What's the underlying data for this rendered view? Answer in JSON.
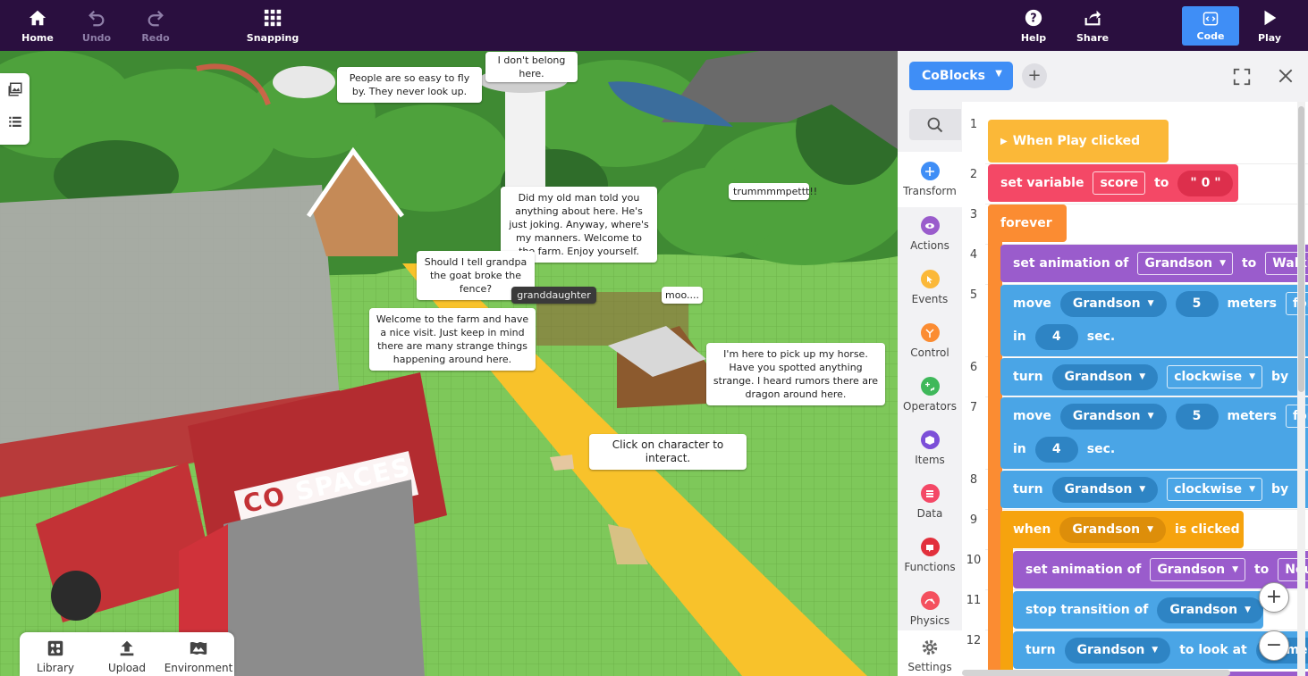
{
  "topbar": {
    "home": "Home",
    "undo": "Undo",
    "redo": "Redo",
    "snapping": "Snapping",
    "help": "Help",
    "share": "Share",
    "code": "Code",
    "play": "Play"
  },
  "scene": {
    "bubbles": {
      "fly": "People are so easy to fly by. They never look up.",
      "belong": "I don't belong here.",
      "oldman": "Did my old man told you anything about here. He's just joking. Anyway, where's my manners. Welcome to the farm. Enjoy yourself.",
      "trumpet": "trummmmpettt!!",
      "grandpa": "Should I tell grandpa the goat broke the fence?",
      "granddaughter": "granddaughter",
      "moo": "moo....",
      "welcome": "Welcome to the farm and have a nice visit. Just keep in mind there are many strange things happening around here.",
      "horse": "I'm here to pick up my horse. Have you spotted anything strange. I heard rumors there are dragon around here.",
      "click": "Click on character to interact."
    },
    "truck_logo_co": "CO",
    "truck_logo_spaces": "SPACES",
    "bottom": {
      "library": "Library",
      "upload": "Upload",
      "environment": "Environment"
    }
  },
  "panel": {
    "tab": "CoBlocks",
    "add": "+",
    "categories": [
      {
        "label": "Transform",
        "color": "#3f8ef6"
      },
      {
        "label": "Actions",
        "color": "#9a5ccc"
      },
      {
        "label": "Events",
        "color": "#fbb838"
      },
      {
        "label": "Control",
        "color": "#fb8c32"
      },
      {
        "label": "Operators",
        "color": "#3fb85a"
      },
      {
        "label": "Items",
        "color": "#7c4fd8"
      },
      {
        "label": "Data",
        "color": "#f44866"
      },
      {
        "label": "Functions",
        "color": "#e2303c"
      },
      {
        "label": "Physics",
        "color": "#f4505e"
      },
      {
        "label": "Settings",
        "color": "#666666"
      }
    ],
    "lines": [
      "1",
      "2",
      "3",
      "4",
      "5",
      "6",
      "7",
      "8",
      "9",
      "10",
      "11",
      "12"
    ],
    "blocks": {
      "b1": "When Play clicked",
      "b2_a": "set variable",
      "b2_var": "score",
      "b2_to": "to",
      "b2_val": "\" 0 \"",
      "b3": "forever",
      "b4_a": "set animation of",
      "b4_obj": "Grandson",
      "b4_to": "to",
      "b4_anim": "Walking",
      "b5_a": "move",
      "b5_obj": "Grandson",
      "b5_n": "5",
      "b5_m": "meters",
      "b5_dir": "forward",
      "b5_in": "in",
      "b5_t": "4",
      "b5_sec": "sec.",
      "b6_a": "turn",
      "b6_obj": "Grandson",
      "b6_dir": "clockwise",
      "b6_by": "by",
      "b7_a": "move",
      "b7_obj": "Grandson",
      "b7_n": "5",
      "b7_m": "meters",
      "b7_dir": "forward",
      "b7_in": "in",
      "b7_t": "4",
      "b7_sec": "sec.",
      "b8_a": "turn",
      "b8_obj": "Grandson",
      "b8_dir": "clockwise",
      "b8_by": "by",
      "b9_a": "when",
      "b9_obj": "Grandson",
      "b9_b": "is clicked",
      "b10_a": "set animation of",
      "b10_obj": "Grandson",
      "b10_to": "to",
      "b10_anim": "Neutral",
      "b11_a": "stop transition of",
      "b11_obj": "Grandson",
      "b12_a": "turn",
      "b12_obj": "Grandson",
      "b12_b": "to look at",
      "b12_c": "Camera"
    },
    "zoom_in": "+",
    "zoom_out": "−"
  }
}
